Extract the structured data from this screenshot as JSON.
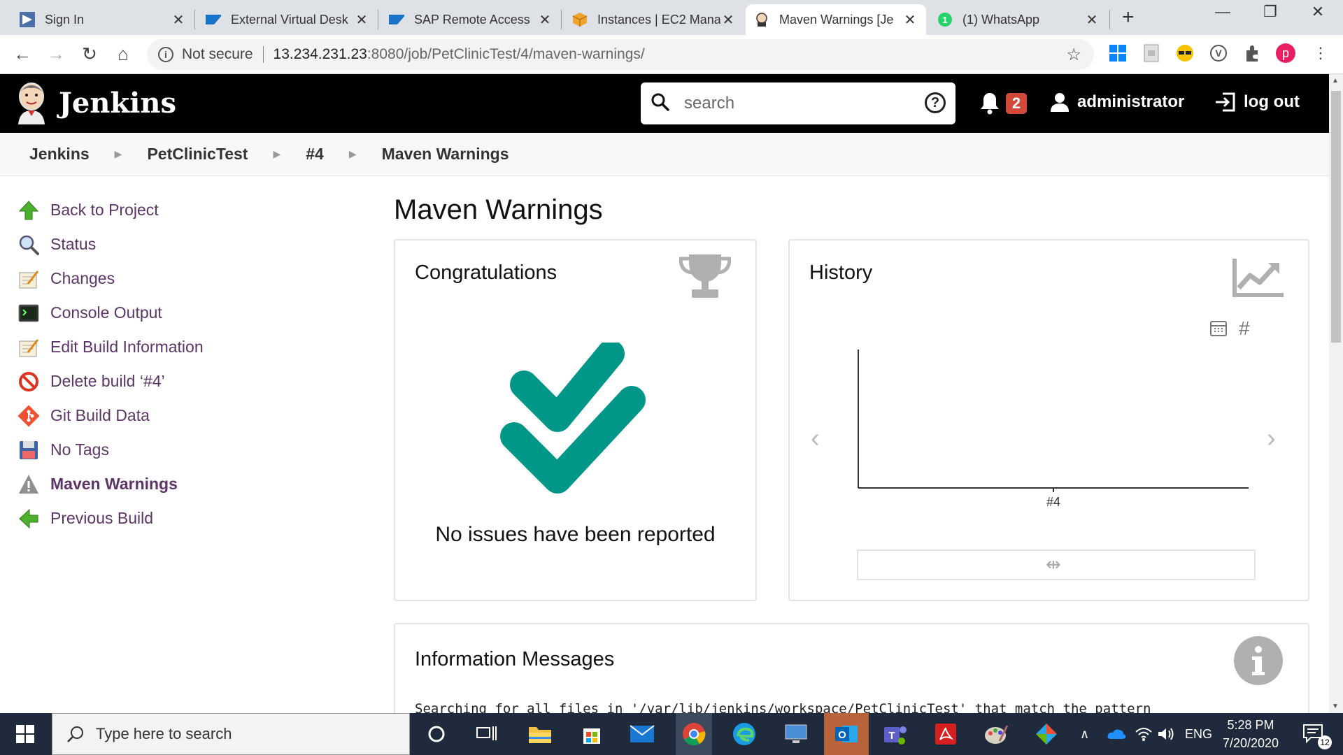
{
  "browser": {
    "tabs": [
      {
        "title": "Sign In",
        "active": false
      },
      {
        "title": "External Virtual Desk",
        "active": false
      },
      {
        "title": "SAP Remote Access",
        "active": false
      },
      {
        "title": "Instances | EC2 Mana",
        "active": false
      },
      {
        "title": "Maven Warnings [Je",
        "active": true
      },
      {
        "title": "(1) WhatsApp",
        "active": false
      }
    ],
    "address": {
      "security_label": "Not secure",
      "host": "13.234.231.23",
      "path": ":8080/job/PetClinicTest/4/maven-warnings/"
    },
    "profile_initial": "p"
  },
  "jenkins": {
    "brand": "Jenkins",
    "search_placeholder": "search",
    "notification_count": "2",
    "user": "administrator",
    "logout": "log out"
  },
  "breadcrumb": [
    "Jenkins",
    "PetClinicTest",
    "#4",
    "Maven Warnings"
  ],
  "sidebar": {
    "items": [
      {
        "label": "Back to Project",
        "icon": "arrow-up-icon"
      },
      {
        "label": "Status",
        "icon": "magnifier-icon"
      },
      {
        "label": "Changes",
        "icon": "notepad-icon"
      },
      {
        "label": "Console Output",
        "icon": "terminal-icon"
      },
      {
        "label": "Edit Build Information",
        "icon": "notepad-icon"
      },
      {
        "label": "Delete build ‘#4’",
        "icon": "no-entry-icon"
      },
      {
        "label": "Git Build Data",
        "icon": "git-icon"
      },
      {
        "label": "No Tags",
        "icon": "floppy-icon"
      },
      {
        "label": "Maven Warnings",
        "icon": "warning-icon"
      },
      {
        "label": "Previous Build",
        "icon": "arrow-left-icon"
      }
    ],
    "current_index": 8
  },
  "main": {
    "title": "Maven Warnings",
    "congratulations": {
      "heading": "Congratulations",
      "message": "No issues have been reported",
      "accent": "#009688"
    },
    "history": {
      "heading": "History",
      "x_tick": "#4"
    },
    "info": {
      "heading": "Information Messages",
      "line": "Searching for all files in '/var/lib/jenkins/workspace/PetClinicTest' that match the pattern"
    }
  },
  "chart_data": {
    "type": "line",
    "categories": [
      "#4"
    ],
    "series": [],
    "title": "",
    "xlabel": "",
    "ylabel": ""
  },
  "taskbar": {
    "search_placeholder": "Type here to search",
    "language": "ENG",
    "time": "5:28 PM",
    "date": "7/20/2020",
    "notification_count": "12"
  }
}
